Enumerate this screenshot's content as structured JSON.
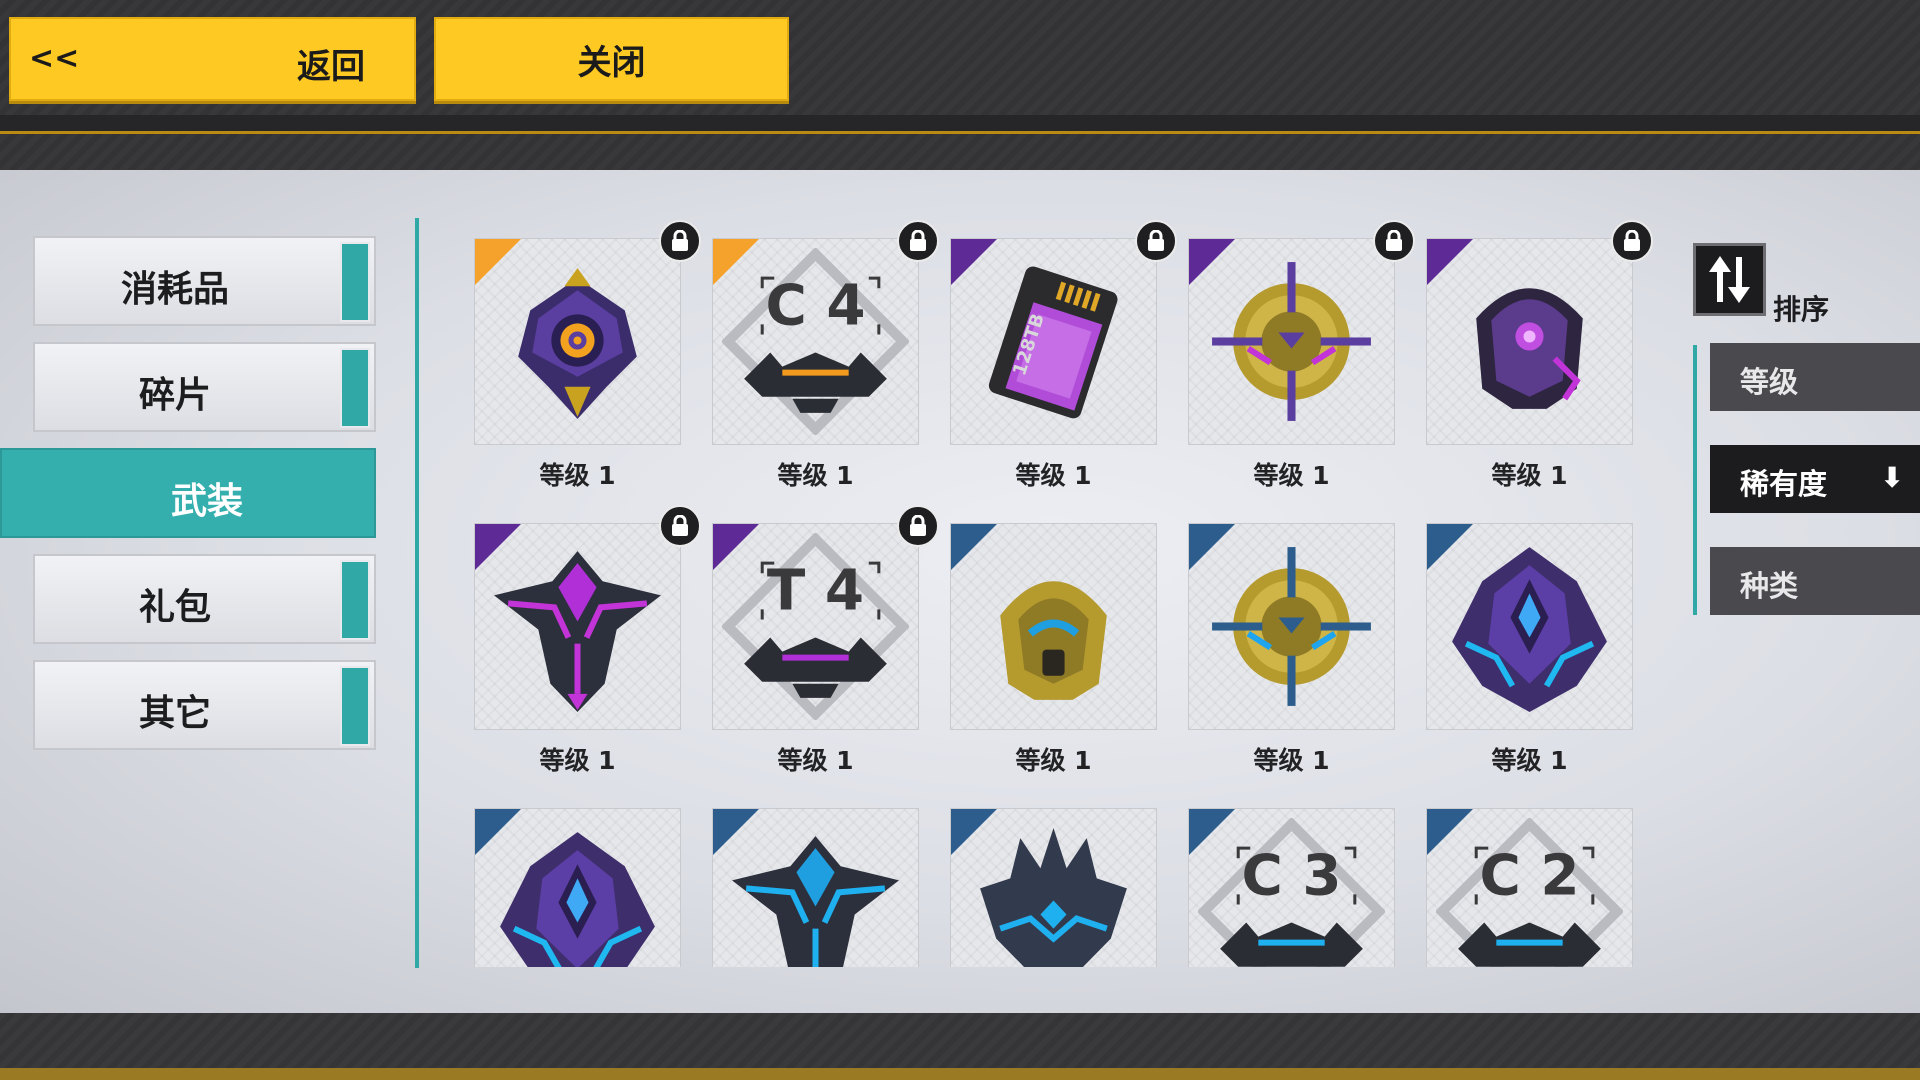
{
  "header": {
    "back_arrows": "<<",
    "back_label": "返回",
    "close_label": "关闭"
  },
  "categories": [
    {
      "label": "消耗品",
      "active": false
    },
    {
      "label": "碎片",
      "active": false
    },
    {
      "label": "武装",
      "active": true
    },
    {
      "label": "礼包",
      "active": false
    },
    {
      "label": "其它",
      "active": false
    }
  ],
  "sort": {
    "label": "排序",
    "options": [
      {
        "label": "等级",
        "active": false
      },
      {
        "label": "稀有度",
        "active": true,
        "direction": "⬇"
      },
      {
        "label": "种类",
        "active": false
      }
    ]
  },
  "rarity_colors": {
    "orange": "#f5a22c",
    "purple": "#5e2a96",
    "blue": "#2d5d8c"
  },
  "items": [
    {
      "level": "等级 1",
      "rarity": "orange",
      "locked": true,
      "icon": "purple-core-module-icon"
    },
    {
      "level": "等级 1",
      "rarity": "orange",
      "locked": true,
      "icon": "c4-blueprint-icon",
      "code": "C 4"
    },
    {
      "level": "等级 1",
      "rarity": "purple",
      "locked": true,
      "icon": "memory-card-icon",
      "card_text": "128TB"
    },
    {
      "level": "等级 1",
      "rarity": "purple",
      "locked": true,
      "icon": "gold-crosshair-purple-icon"
    },
    {
      "level": "等级 1",
      "rarity": "purple",
      "locked": true,
      "icon": "purple-helmet-icon"
    },
    {
      "level": "等级 1",
      "rarity": "purple",
      "locked": true,
      "icon": "purple-wing-emblem-icon"
    },
    {
      "level": "等级 1",
      "rarity": "purple",
      "locked": true,
      "icon": "t4-blueprint-icon",
      "code": "T 4"
    },
    {
      "level": "等级 1",
      "rarity": "blue",
      "locked": false,
      "icon": "gold-helmet-icon"
    },
    {
      "level": "等级 1",
      "rarity": "blue",
      "locked": false,
      "icon": "gold-crosshair-blue-icon"
    },
    {
      "level": "等级 1",
      "rarity": "blue",
      "locked": false,
      "icon": "blue-crystal-emblem-icon"
    },
    {
      "level": "",
      "rarity": "blue",
      "locked": false,
      "icon": "blue-crystal-emblem-icon"
    },
    {
      "level": "",
      "rarity": "blue",
      "locked": false,
      "icon": "blue-wing-emblem-icon"
    },
    {
      "level": "",
      "rarity": "blue",
      "locked": false,
      "icon": "blue-spike-armor-icon"
    },
    {
      "level": "",
      "rarity": "blue",
      "locked": false,
      "icon": "c3-blueprint-icon",
      "code": "C 3"
    },
    {
      "level": "",
      "rarity": "blue",
      "locked": false,
      "icon": "c2-blueprint-icon",
      "code": "C 2"
    }
  ]
}
